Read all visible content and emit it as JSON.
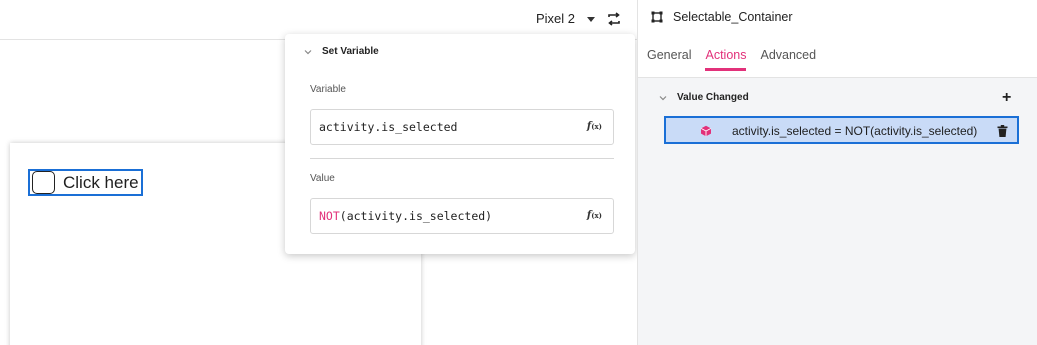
{
  "toolbar": {
    "device_label": "Pixel 2",
    "device_caret_icon": "caret-down-icon",
    "rotate_icon": "rotate-icon"
  },
  "canvas": {
    "checkbox": {
      "label": "Click here",
      "checked": false
    }
  },
  "popover": {
    "title": "Set Variable",
    "variable_label": "Variable",
    "variable_value": "activity.is_selected",
    "value_label": "Value",
    "value_keyword": "NOT",
    "value_rest": "(activity.is_selected)",
    "fx_main": "f",
    "fx_sub": "(x)"
  },
  "panel": {
    "component_name": "Selectable_Container",
    "tabs": [
      {
        "label": "General",
        "active": false
      },
      {
        "label": "Actions",
        "active": true
      },
      {
        "label": "Advanced",
        "active": false
      }
    ],
    "event": {
      "title": "Value Changed",
      "add_label": "+"
    },
    "action": {
      "text": "activity.is_selected = NOT(activity.is_selected)",
      "icon": "variable-cube-icon"
    }
  },
  "colors": {
    "accent": "#e2317a",
    "selection_blue": "#1a6fd6",
    "selection_fill": "#c9dbf7"
  }
}
